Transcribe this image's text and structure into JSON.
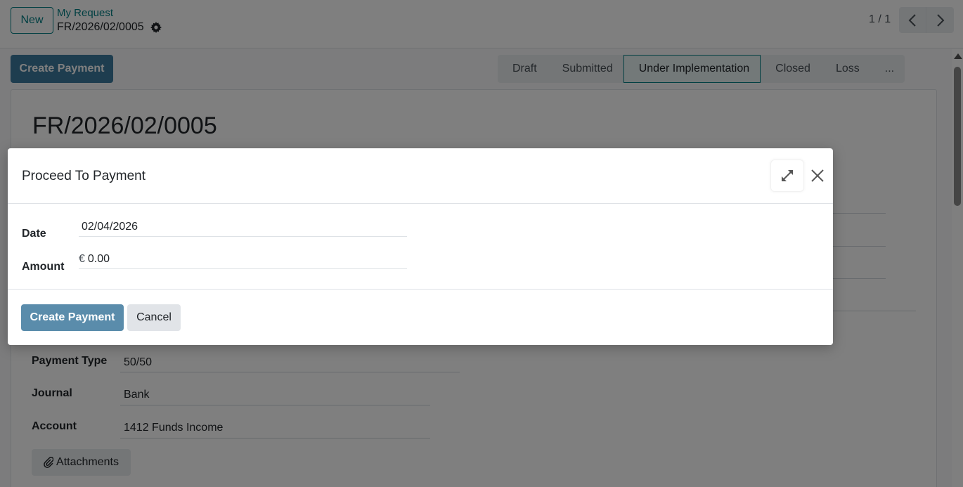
{
  "control_panel": {
    "new_button": "New",
    "breadcrumb_parent": "My Request",
    "breadcrumb_current": "FR/2026/02/0005",
    "pager_value": "1 / 1"
  },
  "header_actions": {
    "create_payment": "Create Payment"
  },
  "statusbar": {
    "stages": [
      "Draft",
      "Submitted",
      "Under Implementation",
      "Closed",
      "Loss",
      "..."
    ],
    "current": "Under Implementation"
  },
  "record": {
    "title": "FR/2026/02/0005",
    "fields": [
      {
        "label": "Payment Type",
        "value": "50/50"
      },
      {
        "label": "Journal",
        "value": "Bank"
      },
      {
        "label": "Account",
        "value": "1412 Funds Income"
      }
    ],
    "attachments_button": "Attachments"
  },
  "dialog": {
    "title": "Proceed To Payment",
    "date_label": "Date",
    "date_value": "02/04/2026",
    "amount_label": "Amount",
    "currency_symbol": "€",
    "amount_value": "0.00",
    "primary_button": "Create Payment",
    "secondary_button": "Cancel"
  },
  "colors": {
    "accent": "#017e84",
    "primary_button": "#5a8cab"
  },
  "icons": [
    "gear-icon",
    "chevron-left-icon",
    "chevron-right-icon",
    "paperclip-icon",
    "expand-icon",
    "close-icon"
  ]
}
